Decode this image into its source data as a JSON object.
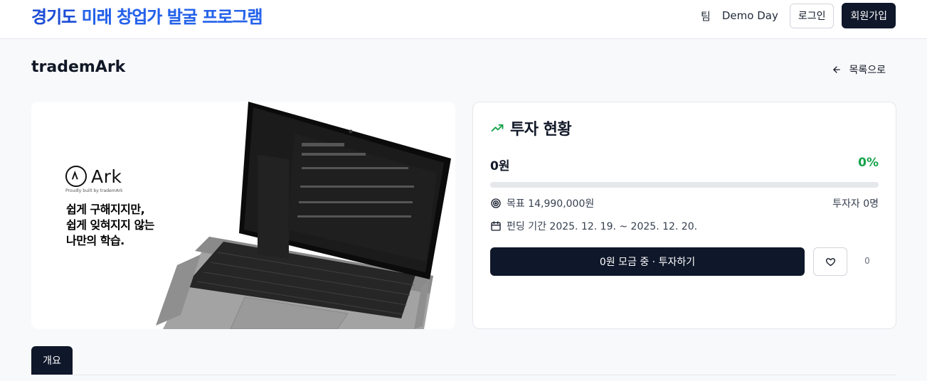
{
  "header": {
    "logo_part1": "경기도 ",
    "logo_part2": "미래 창업가 발굴 프로그램",
    "nav_team": "팀",
    "nav_demoday": "Demo Day",
    "login": "로그인",
    "signup": "회원가입"
  },
  "page": {
    "title": "trademArk",
    "back_label": "목록으로"
  },
  "hero": {
    "brand": "Ark",
    "tagline": "Proudly built by trademArk",
    "copy_line1": "쉽게 구해지지만,",
    "copy_line2": "쉽게 잊혀지지 않는",
    "copy_line3": "나만의 학습."
  },
  "investment": {
    "title": "투자 현황",
    "raised": "0원",
    "percent": "0%",
    "progress_fraction": 0,
    "goal": "목표 14,990,000원",
    "investors": "투자자 0명",
    "period": "펀딩 기간 2025. 12. 19. ~ 2025. 12. 20.",
    "cta": "0원 모금 중 · 투자하기",
    "likes": "0"
  },
  "tabs": {
    "overview": "개요"
  },
  "colors": {
    "primary_dark": "#0f172a",
    "success": "#16a34a",
    "logo_blue": "#1d4ed8"
  }
}
